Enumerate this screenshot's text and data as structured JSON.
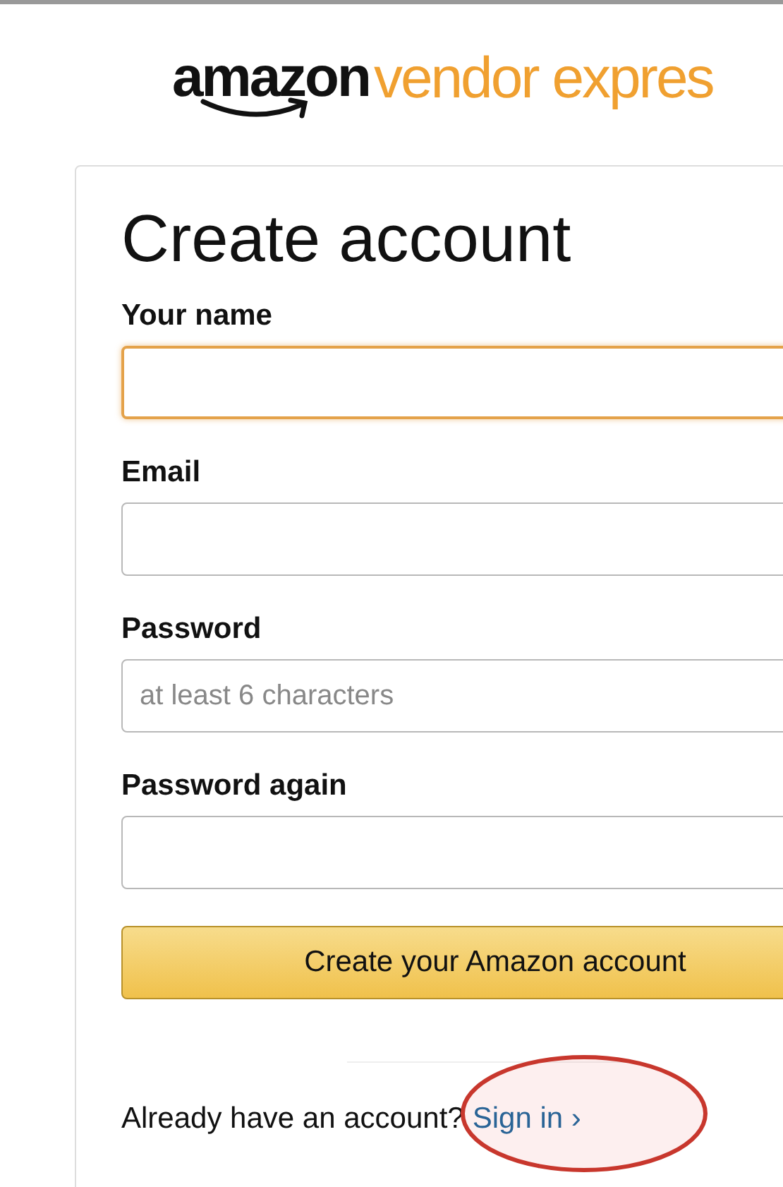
{
  "logo": {
    "brand": "amazon",
    "product": "vendor expres"
  },
  "form": {
    "title": "Create account",
    "fields": [
      {
        "label": "Your name",
        "focused": true
      },
      {
        "label": "Email",
        "focused": false
      },
      {
        "label": "Password",
        "placeholder": "at least 6 characters",
        "focused": false
      },
      {
        "label": "Password again",
        "focused": false
      }
    ],
    "submit": "Create your Amazon account"
  },
  "footer": {
    "prompt": "Already have an account?",
    "link": "Sign in",
    "caret": "›",
    "highlighted": true
  }
}
